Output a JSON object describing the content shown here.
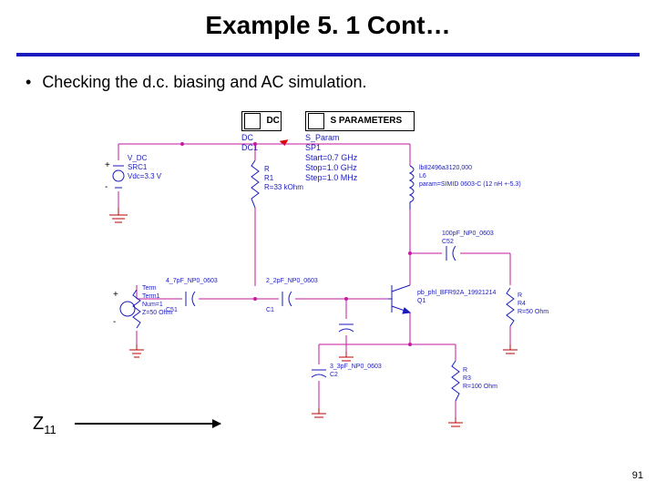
{
  "title": "Example 5. 1 Cont…",
  "bullet": "Checking the d.c. biasing and AC simulation.",
  "z11_label": "Z",
  "z11_sub": "11",
  "page_number": "91",
  "sim": {
    "dc_box_label": "DC",
    "dc_text": "DC\nDC1",
    "sp_box_label": "S PARAMETERS",
    "sp_text": "S_Param\nSP1\nStart=0.7 GHz\nStop=1.0 GHz\nStep=1.0 MHz"
  },
  "components": {
    "vdc": {
      "name": "V_DC",
      "inst": "SRC1",
      "value": "Vdc=3.3 V",
      "plus": "+",
      "minus": "-"
    },
    "r_bias": {
      "name": "R",
      "inst": "R1",
      "value": "R=33 kOhm"
    },
    "inductor_model": {
      "model": "lb82496a3120,000",
      "inst": "L6",
      "param": "param=SIMID 0603-C (12 nH +-5.3)"
    },
    "cap_out": {
      "model": "100pF_NP0_0603",
      "inst": "C52"
    },
    "cap_in1": {
      "model": "4_7pF_NP0_0603",
      "inst": "C51"
    },
    "cap_in2": {
      "model": "2_2pF_NP0_0603",
      "inst": "C1"
    },
    "cap_emit": {
      "model": "3_3pF_NP0_0603",
      "inst": "C2"
    },
    "transistor": {
      "model": "pb_phl_BFR92A_19921214",
      "inst": "Q1"
    },
    "term_in": {
      "name": "Term",
      "inst": "Term1",
      "num": "Num=1",
      "z": "Z=50 Ohm"
    },
    "r_out": {
      "name": "R",
      "inst": "R4",
      "value": "R=50 Ohm"
    },
    "r_emit": {
      "name": "R",
      "inst": "R3",
      "value": "R=100 Ohm"
    }
  }
}
